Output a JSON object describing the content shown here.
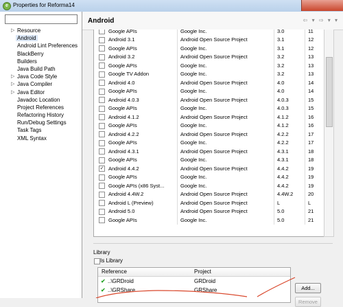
{
  "window": {
    "title": "Properties for Reforma14",
    "app_icon": "eclipse-icon"
  },
  "filter": {
    "value": ""
  },
  "nav": [
    {
      "label": "Resource",
      "expandable": true,
      "selected": false
    },
    {
      "label": "Android",
      "expandable": false,
      "selected": true
    },
    {
      "label": "Android Lint Preferences",
      "expandable": false,
      "selected": false
    },
    {
      "label": "BlackBerry",
      "expandable": false,
      "selected": false
    },
    {
      "label": "Builders",
      "expandable": false,
      "selected": false
    },
    {
      "label": "Java Build Path",
      "expandable": false,
      "selected": false
    },
    {
      "label": "Java Code Style",
      "expandable": true,
      "selected": false
    },
    {
      "label": "Java Compiler",
      "expandable": true,
      "selected": false
    },
    {
      "label": "Java Editor",
      "expandable": true,
      "selected": false
    },
    {
      "label": "Javadoc Location",
      "expandable": false,
      "selected": false
    },
    {
      "label": "Project References",
      "expandable": false,
      "selected": false
    },
    {
      "label": "Refactoring History",
      "expandable": false,
      "selected": false
    },
    {
      "label": "Run/Debug Settings",
      "expandable": false,
      "selected": false
    },
    {
      "label": "Task Tags",
      "expandable": false,
      "selected": false
    },
    {
      "label": "XML Syntax",
      "expandable": false,
      "selected": false
    }
  ],
  "header": {
    "title": "Android",
    "nav_icons": "⇦ ▾ ⇨ ▾ ▾"
  },
  "targets": [
    {
      "checked": false,
      "name": "Google APIs",
      "vendor": "Google Inc.",
      "platform": "3.0",
      "api": "11"
    },
    {
      "checked": false,
      "name": "Android 3.1",
      "vendor": "Android Open Source Project",
      "platform": "3.1",
      "api": "12"
    },
    {
      "checked": false,
      "name": "Google APIs",
      "vendor": "Google Inc.",
      "platform": "3.1",
      "api": "12"
    },
    {
      "checked": false,
      "name": "Android 3.2",
      "vendor": "Android Open Source Project",
      "platform": "3.2",
      "api": "13"
    },
    {
      "checked": false,
      "name": "Google APIs",
      "vendor": "Google Inc.",
      "platform": "3.2",
      "api": "13"
    },
    {
      "checked": false,
      "name": "Google TV Addon",
      "vendor": "Google Inc.",
      "platform": "3.2",
      "api": "13"
    },
    {
      "checked": false,
      "name": "Android 4.0",
      "vendor": "Android Open Source Project",
      "platform": "4.0",
      "api": "14"
    },
    {
      "checked": false,
      "name": "Google APIs",
      "vendor": "Google Inc.",
      "platform": "4.0",
      "api": "14"
    },
    {
      "checked": false,
      "name": "Android 4.0.3",
      "vendor": "Android Open Source Project",
      "platform": "4.0.3",
      "api": "15"
    },
    {
      "checked": false,
      "name": "Google APIs",
      "vendor": "Google Inc.",
      "platform": "4.0.3",
      "api": "15"
    },
    {
      "checked": false,
      "name": "Android 4.1.2",
      "vendor": "Android Open Source Project",
      "platform": "4.1.2",
      "api": "16"
    },
    {
      "checked": false,
      "name": "Google APIs",
      "vendor": "Google Inc.",
      "platform": "4.1.2",
      "api": "16"
    },
    {
      "checked": false,
      "name": "Android 4.2.2",
      "vendor": "Android Open Source Project",
      "platform": "4.2.2",
      "api": "17"
    },
    {
      "checked": false,
      "name": "Google APIs",
      "vendor": "Google Inc.",
      "platform": "4.2.2",
      "api": "17"
    },
    {
      "checked": false,
      "name": "Android 4.3.1",
      "vendor": "Android Open Source Project",
      "platform": "4.3.1",
      "api": "18"
    },
    {
      "checked": false,
      "name": "Google APIs",
      "vendor": "Google Inc.",
      "platform": "4.3.1",
      "api": "18"
    },
    {
      "checked": true,
      "name": "Android 4.4.2",
      "vendor": "Android Open Source Project",
      "platform": "4.4.2",
      "api": "19"
    },
    {
      "checked": false,
      "name": "Google APIs",
      "vendor": "Google Inc.",
      "platform": "4.4.2",
      "api": "19"
    },
    {
      "checked": false,
      "name": "Google APIs (x86 Syst...",
      "vendor": "Google Inc.",
      "platform": "4.4.2",
      "api": "19"
    },
    {
      "checked": false,
      "name": "Android 4.4W.2",
      "vendor": "Android Open Source Project",
      "platform": "4.4W.2",
      "api": "20"
    },
    {
      "checked": false,
      "name": "Android L (Preview)",
      "vendor": "Android Open Source Project",
      "platform": "L",
      "api": "L"
    },
    {
      "checked": false,
      "name": "Android 5.0",
      "vendor": "Android Open Source Project",
      "platform": "5.0",
      "api": "21"
    },
    {
      "checked": false,
      "name": "Google APIs",
      "vendor": "Google Inc.",
      "platform": "5.0",
      "api": "21"
    }
  ],
  "library": {
    "label": "Library",
    "is_library_label": "Is Library",
    "is_library_checked": false,
    "columns": [
      "Reference",
      "Project"
    ],
    "rows": [
      {
        "reference": "..\\GRDroid",
        "project": "GRDroid",
        "status": "check-icon"
      },
      {
        "reference": "..\\GRShare",
        "project": "GRShare",
        "status": "check-icon"
      }
    ],
    "add_label": "Add...",
    "remove_label": "Remove"
  },
  "colors": {
    "annotation": "#d9472b",
    "selection": "#dbe7f6",
    "ok": "#28a428"
  }
}
